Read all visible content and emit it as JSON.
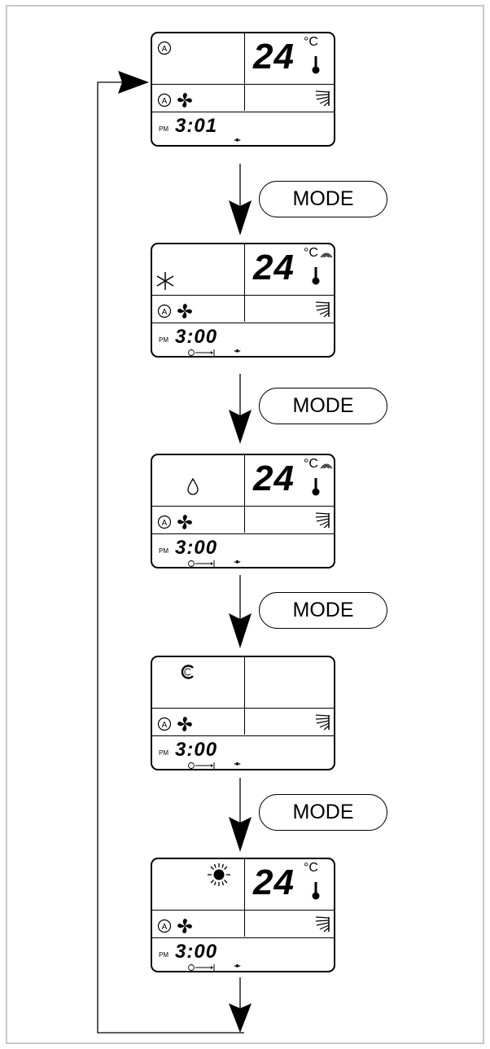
{
  "mode_button_label": "MODE",
  "temperature_unit": "°C",
  "am_pm": "PM",
  "panels": [
    {
      "mode_icon": "auto-a-icon",
      "temperature": "24",
      "time": "3:01",
      "timer_mark": false
    },
    {
      "mode_icon": "snowflake-cool-icon",
      "temperature": "24",
      "time": "3:00",
      "timer_mark": true
    },
    {
      "mode_icon": "droplet-dry-icon",
      "temperature": "24",
      "time": "3:00",
      "timer_mark": true
    },
    {
      "mode_icon": "fan-c-icon",
      "temperature": "",
      "time": "3:00",
      "timer_mark": true
    },
    {
      "mode_icon": "sun-heat-icon",
      "temperature": "24",
      "time": "3:00",
      "timer_mark": true
    }
  ],
  "fan_speed_indicator": "auto-a-icon"
}
